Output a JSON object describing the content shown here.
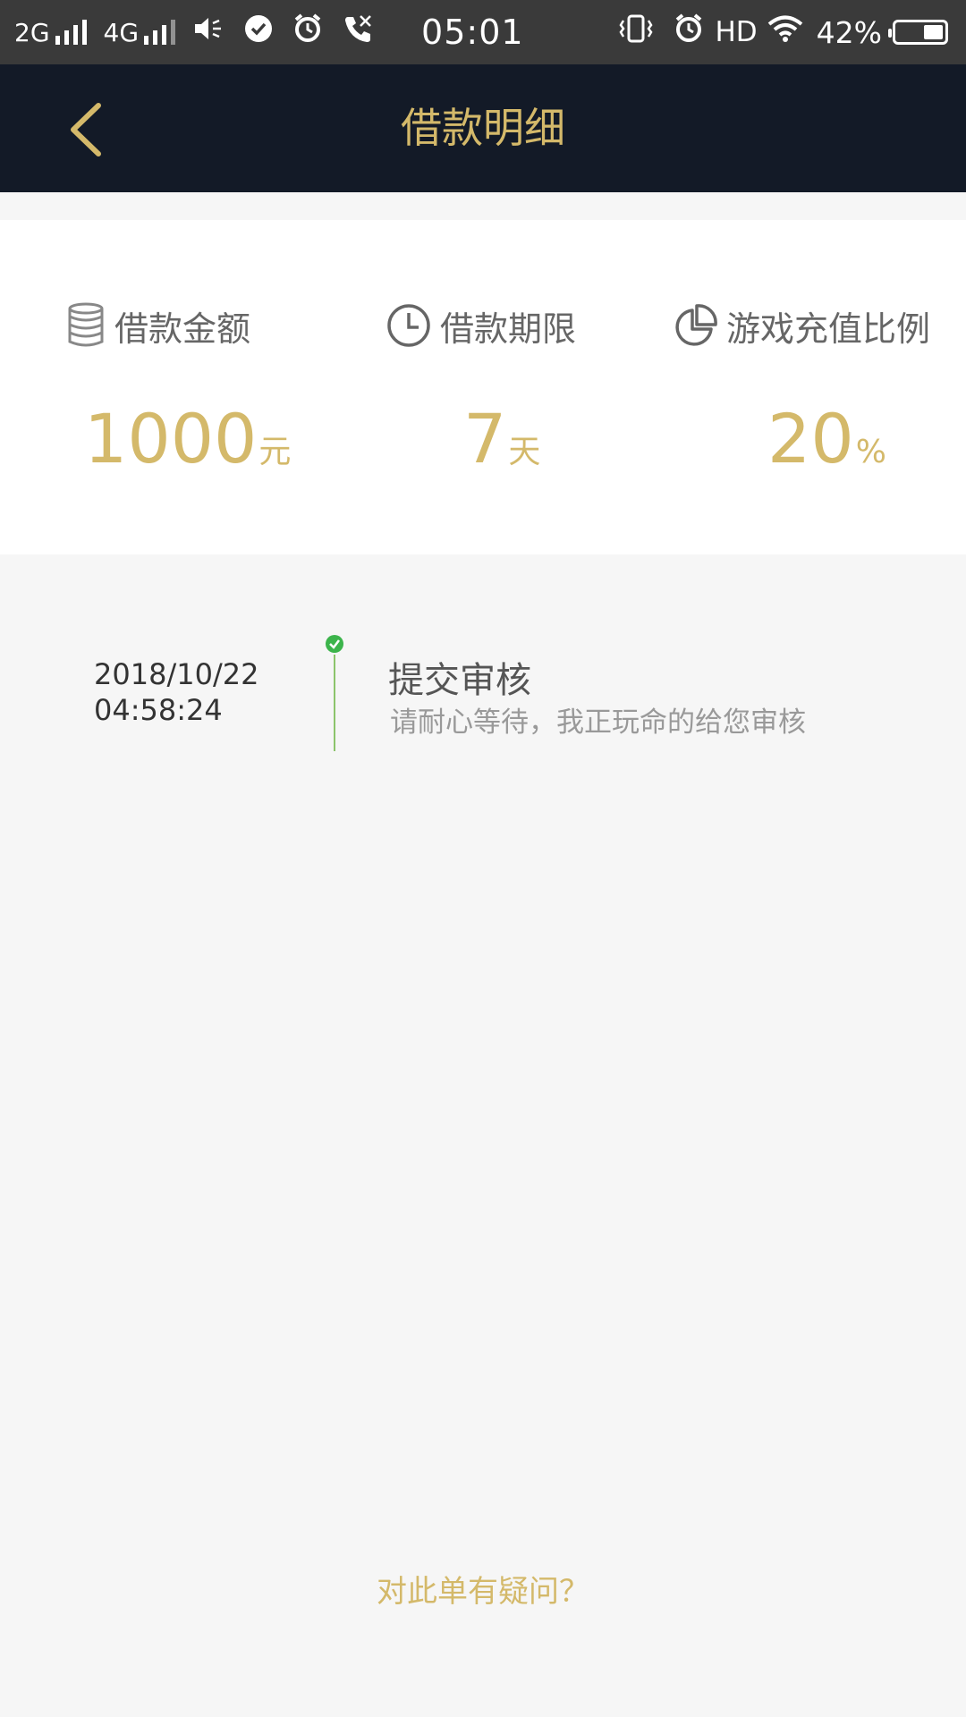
{
  "status_bar": {
    "network_1": "2G",
    "network_2": "4G",
    "time": "05:01",
    "hd": "HD",
    "battery_percent": "42%",
    "battery_level": 0.42
  },
  "header": {
    "title": "借款明细"
  },
  "summary": {
    "amount": {
      "label": "借款金额",
      "value": "1000",
      "unit": "元",
      "icon": "coin-stack-icon"
    },
    "term": {
      "label": "借款期限",
      "value": "7",
      "unit": "天",
      "icon": "clock-icon"
    },
    "ratio": {
      "label": "游戏充值比例",
      "value": "20",
      "unit": "%",
      "icon": "pie-chart-icon"
    }
  },
  "timeline": [
    {
      "date": "2018/10/22",
      "time": "04:58:24",
      "title": "提交审核",
      "description": "请耐心等待，我正玩命的给您审核",
      "status": "done"
    }
  ],
  "footer": {
    "question_link": "对此单有疑问？"
  },
  "colors": {
    "accent_gold": "#d4b96a",
    "header_bg": "#131a27",
    "status_green": "#3cb44b"
  }
}
